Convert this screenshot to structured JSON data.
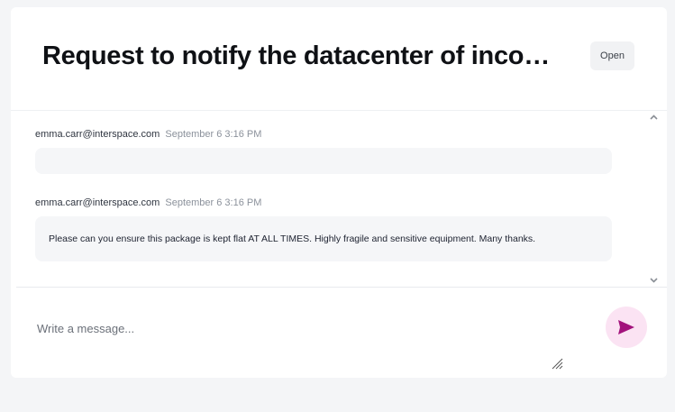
{
  "ticket": {
    "title": "Request to notify the datacenter of incoming package",
    "status": "Open"
  },
  "messages": [
    {
      "author": "emma.carr@interspace.com",
      "time": "September 6 3:16 PM",
      "body": ""
    },
    {
      "author": "emma.carr@interspace.com",
      "time": "September 6 3:16 PM",
      "body": "Please can you ensure this package is kept flat AT ALL TIMES. Highly fragile and sensitive equipment. Many thanks."
    }
  ],
  "composer": {
    "placeholder": "Write a message...",
    "value": ""
  },
  "colors": {
    "page_bg": "#f4f5f7",
    "card_bg": "#ffffff",
    "bubble_bg": "#f5f6f8",
    "send_button_bg": "#fbe3f3",
    "send_icon": "#a3127c"
  },
  "icons": {
    "send": "send-icon",
    "scroll_up": "chevron-up-icon",
    "scroll_down": "chevron-down-icon",
    "resize": "resize-handle-icon"
  }
}
